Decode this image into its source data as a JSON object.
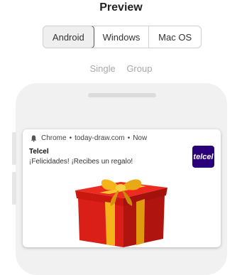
{
  "header": {
    "title": "Preview"
  },
  "platforms": {
    "items": [
      "Android",
      "Windows",
      "Mac OS"
    ],
    "selected": "Android"
  },
  "view_modes": {
    "items": [
      "Single",
      "Group"
    ]
  },
  "notification": {
    "app": "Chrome",
    "domain": "today-draw.com",
    "time": "Now",
    "sender": "Telcel",
    "message": "¡Felicidades! ¡Recibes un regalo!",
    "logo_text": "telcel"
  },
  "colors": {
    "logo_bg": "#2a007a",
    "gift_red": "#e0231a",
    "ribbon_gold": "#f4b41a"
  }
}
